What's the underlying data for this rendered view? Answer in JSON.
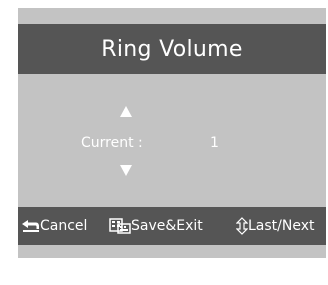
{
  "title": "Ring Volume",
  "setting": {
    "label": "Current :",
    "value": "1",
    "up_icon": "up-arrow-icon",
    "down_icon": "down-arrow-icon"
  },
  "footer": {
    "cancel": {
      "label": "Cancel",
      "icon": "back-arrow-icon"
    },
    "save": {
      "label": "Save&Exit",
      "icon": "keyboard-icon"
    },
    "next": {
      "label": "Last/Next",
      "icon": "up-down-icon"
    }
  },
  "colors": {
    "bar": "#555555",
    "panel": "#c3c3c3",
    "text": "#ffffff"
  }
}
